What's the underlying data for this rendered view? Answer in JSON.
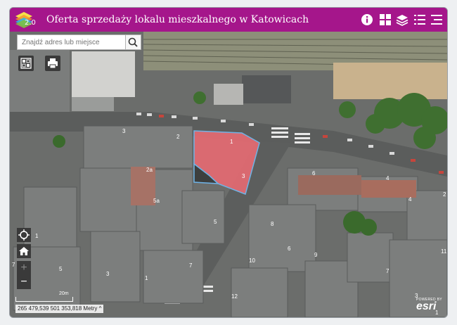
{
  "header": {
    "title": "Oferta sprzedaży lokalu mieszkalnego w Katowicach",
    "logo_version": "2.0",
    "icons": [
      "info-icon",
      "basemap-gallery-icon",
      "layers-icon",
      "legend-icon",
      "menu-icon"
    ]
  },
  "search": {
    "placeholder": "Znajdź adres lub miejsce",
    "button_icon": "search-icon"
  },
  "tools": {
    "buttons": [
      "overview-map-icon",
      "print-icon"
    ]
  },
  "navigation": {
    "buttons": [
      "locate-icon",
      "home-icon",
      "zoom-in-icon",
      "zoom-out-icon"
    ],
    "zoom_in": "+",
    "zoom_out": "−"
  },
  "status": {
    "coordinates": "265 479,539 501 353,818 Metry",
    "scale_label": "20m",
    "attribution_powered": "POWERED BY",
    "attribution_brand": "esri"
  },
  "map": {
    "labels": [
      "1",
      "3",
      "2",
      "2a",
      "5a",
      "5",
      "4",
      "6",
      "7",
      "8",
      "9",
      "10",
      "11",
      "12",
      "1",
      "3",
      "5",
      "7",
      "1",
      "3",
      "4",
      "6",
      "7",
      "2",
      "1"
    ],
    "colors": {
      "highlight_fill": "#e46a72",
      "highlight_stroke": "#6fb3e6",
      "header": "#a5168b"
    }
  }
}
